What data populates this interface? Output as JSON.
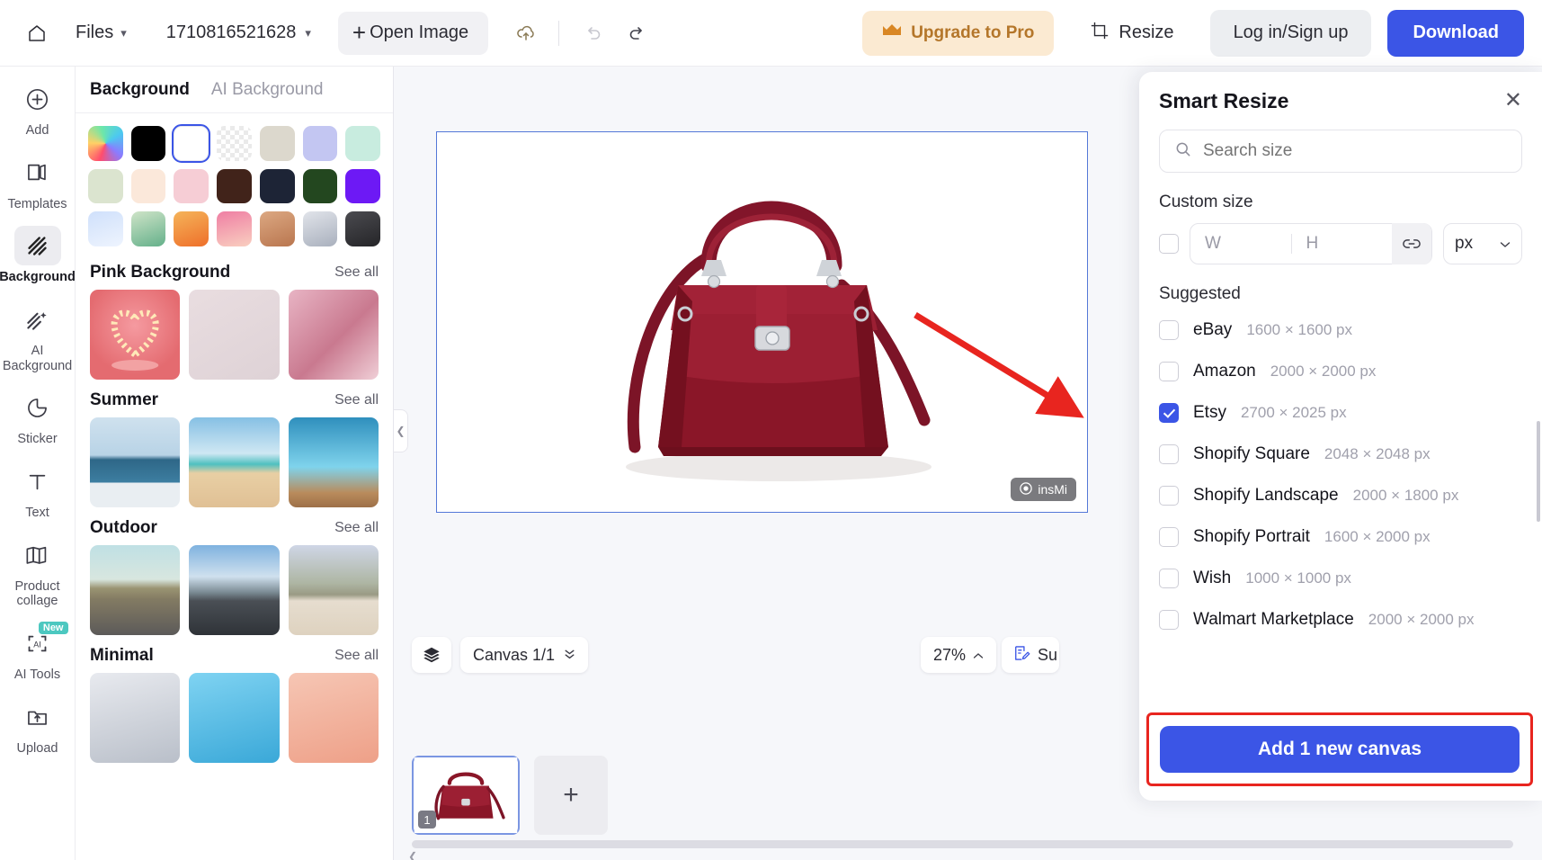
{
  "topbar": {
    "home_icon": "home-icon",
    "files_label": "Files",
    "doc_name": "1710816521628",
    "open_image_label": "Open Image",
    "open_image_plus": "+",
    "cloud_icon": "cloud-upload-icon",
    "undo_icon": "undo-icon",
    "redo_icon": "redo-icon",
    "upgrade_label": "Upgrade to Pro",
    "upgrade_icon": "crown-icon",
    "upgrade_color": "#b4762a",
    "upgrade_bg": "#fbead2",
    "resize_label": "Resize",
    "resize_icon": "crop-icon",
    "login_label": "Log in/Sign up",
    "download_label": "Download",
    "download_bg": "#3b55e6"
  },
  "rail": {
    "items": [
      {
        "label": "Add",
        "icon": "plus-circle-icon",
        "active": false
      },
      {
        "label": "Templates",
        "icon": "templates-icon",
        "active": false
      },
      {
        "label": "Background",
        "icon": "background-hatch-icon",
        "active": true
      },
      {
        "label": "AI Background",
        "icon": "ai-background-icon",
        "active": false
      },
      {
        "label": "Sticker",
        "icon": "sticker-icon",
        "active": false
      },
      {
        "label": "Text",
        "icon": "text-t-icon",
        "active": false
      },
      {
        "label": "Product collage",
        "icon": "collage-icon",
        "active": false
      },
      {
        "label": "AI Tools",
        "icon": "ai-tools-icon",
        "active": false,
        "badge": "New"
      },
      {
        "label": "Upload",
        "icon": "upload-folder-icon",
        "active": false
      }
    ]
  },
  "panel": {
    "tabs": [
      {
        "label": "Background",
        "active": true
      },
      {
        "label": "AI Background",
        "active": false
      }
    ],
    "swatches": [
      {
        "name": "rainbow-gradient",
        "selected": false
      },
      {
        "name": "black",
        "selected": false
      },
      {
        "name": "white",
        "selected": true
      },
      {
        "name": "transparent",
        "selected": false
      },
      {
        "name": "beige",
        "selected": false
      },
      {
        "name": "periwinkle",
        "selected": false
      },
      {
        "name": "mint",
        "selected": false
      },
      {
        "name": "sage",
        "selected": false
      },
      {
        "name": "cream",
        "selected": false
      },
      {
        "name": "blush-pink",
        "selected": false
      },
      {
        "name": "dark-brown",
        "selected": false
      },
      {
        "name": "navy",
        "selected": false
      },
      {
        "name": "forest-green",
        "selected": false
      },
      {
        "name": "violet",
        "selected": false
      },
      {
        "name": "light-blue-gradient",
        "selected": false
      },
      {
        "name": "green-gradient",
        "selected": false
      },
      {
        "name": "orange-gradient",
        "selected": false
      },
      {
        "name": "pink-gradient",
        "selected": false
      },
      {
        "name": "tan-gradient",
        "selected": false
      },
      {
        "name": "silver-gradient",
        "selected": false
      },
      {
        "name": "charcoal-gradient",
        "selected": false
      }
    ],
    "sections": [
      {
        "title": "Pink Background",
        "see_all": "See all",
        "thumbs": [
          "pink-heart-podium",
          "pink-flower-wall",
          "pink-window-light"
        ]
      },
      {
        "title": "Summer",
        "see_all": "See all",
        "thumbs": [
          "ocean-horizon",
          "beach-sand-sky",
          "pool-water-deck"
        ]
      },
      {
        "title": "Outdoor",
        "see_all": "See all",
        "thumbs": [
          "desert-road",
          "city-skyline-road",
          "hill-wood-floor"
        ]
      },
      {
        "title": "Minimal",
        "see_all": "See all",
        "thumbs": [
          "gray-gradient",
          "blue-gradient",
          "peach-gradient"
        ]
      }
    ],
    "collapse_icon": "chevron-left-icon"
  },
  "stage": {
    "canvas_image": "red-leather-handbag",
    "watermark": "insMi",
    "watermark_icon": "insmind-logo-icon",
    "layers_icon": "layers-icon",
    "canvas_selector": "Canvas 1/1",
    "canvas_selector_icon": "chevron-updown-icon",
    "zoom_level": "27%",
    "zoom_icon": "chevron-up-icon",
    "su_label": "Su",
    "su_icon": "suggestion-edit-icon",
    "filmstrip": {
      "page_number": "1",
      "add_icon": "+",
      "scroll_left_icon": "chevron-left-icon"
    }
  },
  "smart_resize": {
    "title": "Smart Resize",
    "close_icon": "close-icon",
    "search": {
      "placeholder": "Search size",
      "icon": "search-icon",
      "value": ""
    },
    "custom_size_label": "Custom size",
    "custom": {
      "checked": false,
      "width_placeholder": "W",
      "width_value": "",
      "height_placeholder": "H",
      "height_value": "",
      "link_icon": "link-aspect-icon",
      "unit": "px",
      "unit_icon": "chevron-down-icon"
    },
    "suggested_label": "Suggested",
    "suggested": [
      {
        "name": "eBay",
        "dims": "1600 × 1600 px",
        "checked": false
      },
      {
        "name": "Amazon",
        "dims": "2000 × 2000 px",
        "checked": false
      },
      {
        "name": "Etsy",
        "dims": "2700 × 2025 px",
        "checked": true
      },
      {
        "name": "Shopify Square",
        "dims": "2048 × 2048 px",
        "checked": false
      },
      {
        "name": "Shopify Landscape",
        "dims": "2000 × 1800 px",
        "checked": false
      },
      {
        "name": "Shopify Portrait",
        "dims": "1600 × 2000 px",
        "checked": false
      },
      {
        "name": "Wish",
        "dims": "1000 × 1000 px",
        "checked": false
      },
      {
        "name": "Walmart Marketplace",
        "dims": "2000 × 2000 px",
        "checked": false
      }
    ],
    "cta_label": "Add 1 new canvas",
    "cta_color": "#3b55e6",
    "highlight_color": "#e8251f"
  },
  "annotation": {
    "arrow_color": "#e8251f",
    "arrow_name": "red-pointer-arrow"
  }
}
